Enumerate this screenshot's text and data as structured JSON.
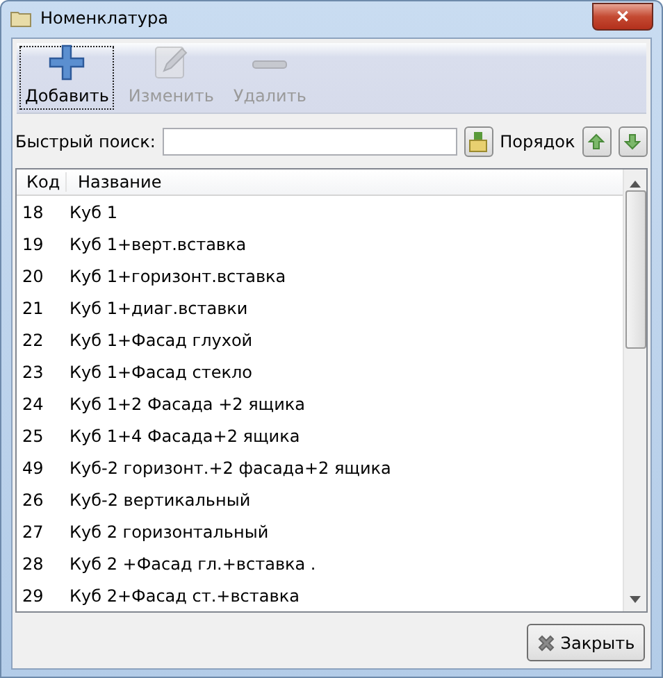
{
  "window": {
    "title": "Номенклатура",
    "close_glyph": "✕"
  },
  "toolbar": [
    {
      "kind": "add",
      "label": "Добавить",
      "disabled": false,
      "focused": true
    },
    {
      "kind": "edit",
      "label": "Изменить",
      "disabled": true,
      "focused": false
    },
    {
      "kind": "delete",
      "label": "Удалить",
      "disabled": true,
      "focused": false
    }
  ],
  "search": {
    "label": "Быстрый поиск:"
  },
  "order": {
    "label": "Порядок"
  },
  "table": {
    "columns": [
      "Код",
      "Название"
    ],
    "rows": [
      [
        "18",
        "Куб 1"
      ],
      [
        "19",
        "Куб 1+верт.вставка"
      ],
      [
        "20",
        "Куб 1+горизонт.вставка"
      ],
      [
        "21",
        "Куб 1+диаг.вставки"
      ],
      [
        "22",
        "Куб 1+Фасад глухой"
      ],
      [
        "23",
        "Куб 1+Фасад стекло"
      ],
      [
        "24",
        "Куб 1+2 Фасада +2 ящика"
      ],
      [
        "25",
        "Куб 1+4 Фасада+2 ящика"
      ],
      [
        "49",
        "Куб-2 горизонт.+2 фасада+2 ящика"
      ],
      [
        "26",
        "Куб-2 вертикальный"
      ],
      [
        "27",
        "Куб 2 горизонтальный"
      ],
      [
        "28",
        "Куб 2 +Фасад гл.+вставка ."
      ],
      [
        "29",
        "Куб 2+Фасад ст.+вставка"
      ]
    ]
  },
  "close_button": {
    "label": "Закрыть"
  }
}
